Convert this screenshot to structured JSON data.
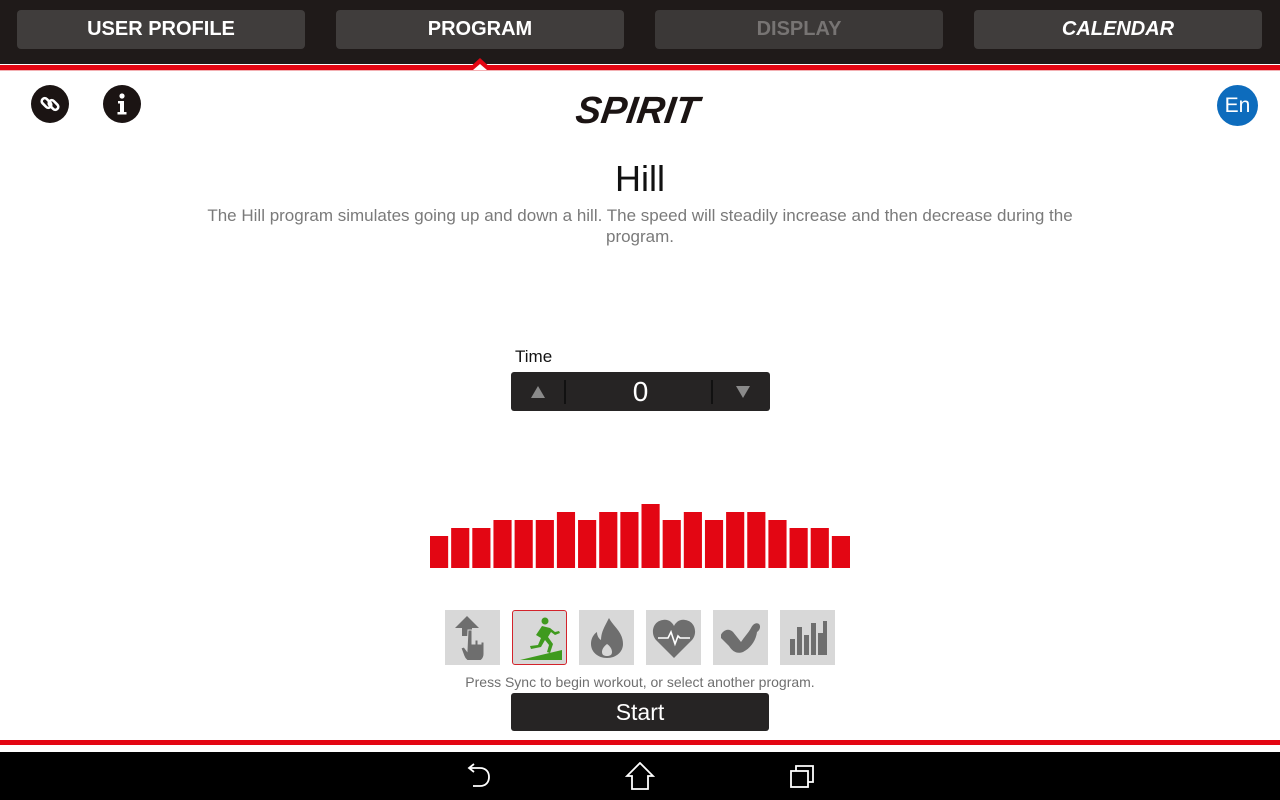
{
  "tabs": [
    {
      "label": "USER PROFILE",
      "state": "normal"
    },
    {
      "label": "PROGRAM",
      "state": "active"
    },
    {
      "label": "DISPLAY",
      "state": "disabled"
    },
    {
      "label": "CALENDAR",
      "state": "normal"
    }
  ],
  "header": {
    "link_icon": "link-icon",
    "info_icon": "info-icon",
    "brand": "SPIRIT",
    "language": "En"
  },
  "program": {
    "title": "Hill",
    "description": "The Hill program simulates going up and down a hill. The speed will steadily increase and then decrease during the program."
  },
  "time": {
    "label": "Time",
    "value": "0",
    "up_icon": "triangle-up-icon",
    "down_icon": "triangle-down-icon"
  },
  "colors": {
    "accent": "#e30613",
    "topbar": "#1f1a19",
    "tab": "#403d3c",
    "language_badge": "#0d6cbd",
    "selected_program": "#3f9a1e"
  },
  "profile_chart": {
    "type": "bar",
    "levels": [
      4,
      5,
      5,
      6,
      6,
      6,
      7,
      6,
      7,
      7,
      8,
      6,
      7,
      6,
      7,
      7,
      6,
      5,
      5,
      4
    ],
    "max_level": 9
  },
  "program_icons": [
    {
      "name": "manual-icon",
      "selected": false
    },
    {
      "name": "hill-runner-icon",
      "selected": true
    },
    {
      "name": "fat-burn-icon",
      "selected": false
    },
    {
      "name": "heart-rate-icon",
      "selected": false
    },
    {
      "name": "strength-arm-icon",
      "selected": false
    },
    {
      "name": "interval-bars-icon",
      "selected": false
    }
  ],
  "hint": "Press Sync to begin workout, or select another program.",
  "start_label": "Start",
  "navbar": [
    "back-icon",
    "home-icon",
    "recent-apps-icon"
  ]
}
